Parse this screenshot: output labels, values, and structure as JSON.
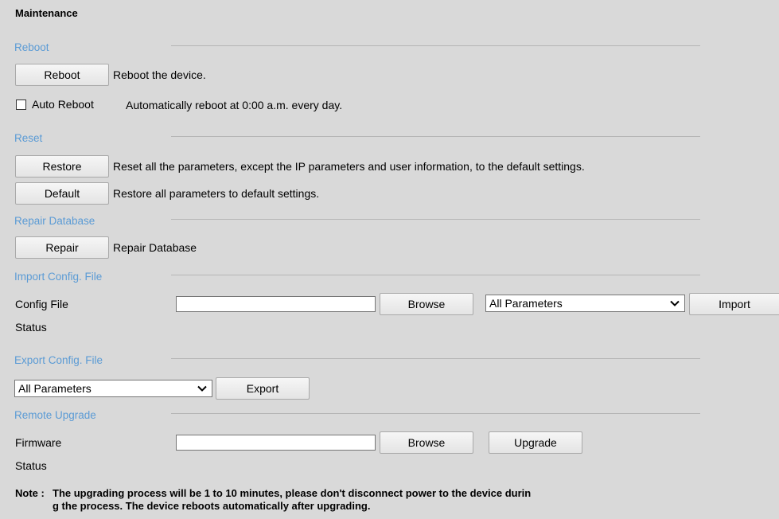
{
  "title": "Maintenance",
  "reboot": {
    "section_title": "Reboot",
    "button_label": "Reboot",
    "description": "Reboot the device.",
    "auto_reboot_label": "Auto Reboot",
    "auto_reboot_description": "Automatically reboot at 0:00 a.m. every day.",
    "auto_reboot_checked": false
  },
  "reset": {
    "section_title": "Reset",
    "restore_label": "Restore",
    "restore_description": "Reset all the parameters, except the IP parameters and user information, to the default settings.",
    "default_label": "Default",
    "default_description": "Restore all parameters to default settings."
  },
  "repair": {
    "section_title": "Repair Database",
    "button_label": "Repair",
    "description": "Repair Database"
  },
  "import_config": {
    "section_title": "Import Config. File",
    "file_label": "Config File",
    "file_value": "",
    "browse_label": "Browse",
    "select_value": "All Parameters",
    "import_label": "Import",
    "status_label": "Status"
  },
  "export_config": {
    "section_title": "Export Config. File",
    "select_value": "All Parameters",
    "export_label": "Export"
  },
  "remote_upgrade": {
    "section_title": "Remote Upgrade",
    "firmware_label": "Firmware",
    "file_value": "",
    "browse_label": "Browse",
    "upgrade_label": "Upgrade",
    "status_label": "Status"
  },
  "note": {
    "label": "Note :",
    "line1": "The upgrading process will be 1 to 10 minutes, please don't disconnect power to the device durin",
    "line2": "g the process. The device reboots automatically after upgrading."
  }
}
